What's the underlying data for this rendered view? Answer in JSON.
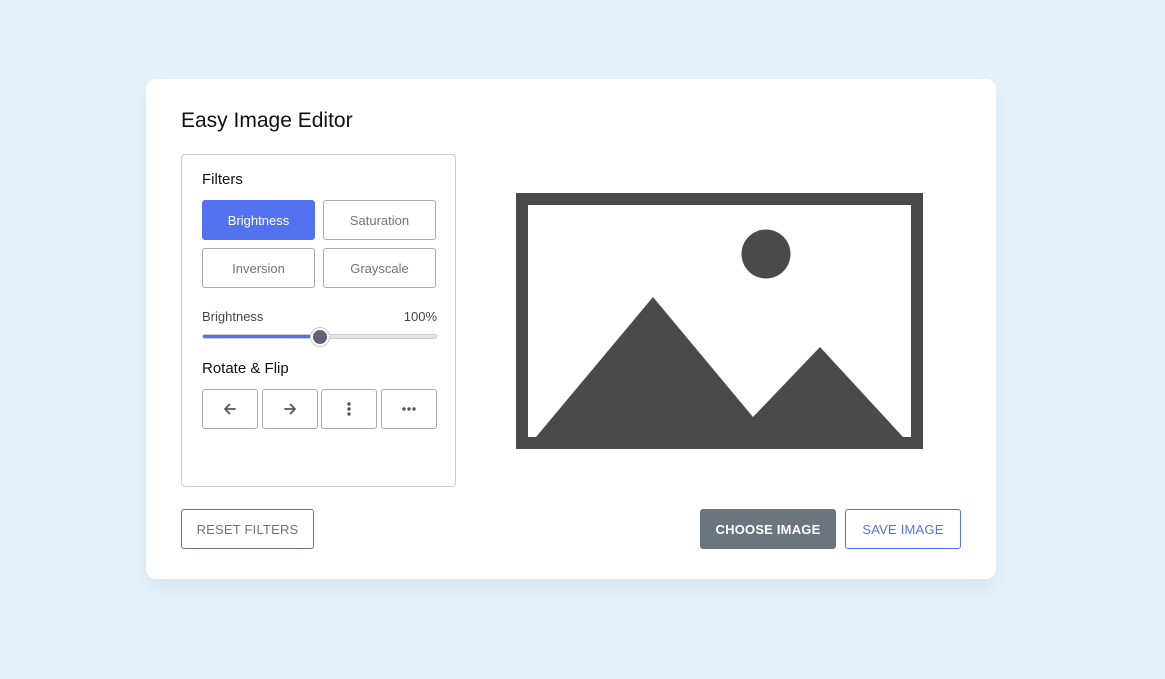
{
  "app": {
    "title": "Easy Image Editor"
  },
  "filters": {
    "heading": "Filters",
    "options": [
      {
        "label": "Brightness",
        "active": true
      },
      {
        "label": "Saturation",
        "active": false
      },
      {
        "label": "Inversion",
        "active": false
      },
      {
        "label": "Grayscale",
        "active": false
      }
    ]
  },
  "slider": {
    "name": "Brightness",
    "value_text": "100%",
    "value": 100,
    "max": 200
  },
  "rotate": {
    "heading": "Rotate & Flip",
    "buttons": [
      {
        "icon": "arrow-left-icon"
      },
      {
        "icon": "arrow-right-icon"
      },
      {
        "icon": "vertical-dots-icon"
      },
      {
        "icon": "horizontal-dots-icon"
      }
    ]
  },
  "preview": {
    "icon": "image-placeholder-icon"
  },
  "actions": {
    "reset_label": "RESET FILTERS",
    "choose_label": "CHOOSE IMAGE",
    "save_label": "SAVE IMAGE"
  },
  "colors": {
    "accent": "#5372f0",
    "secondary": "#6c757d",
    "background": "#e3f2fd"
  }
}
